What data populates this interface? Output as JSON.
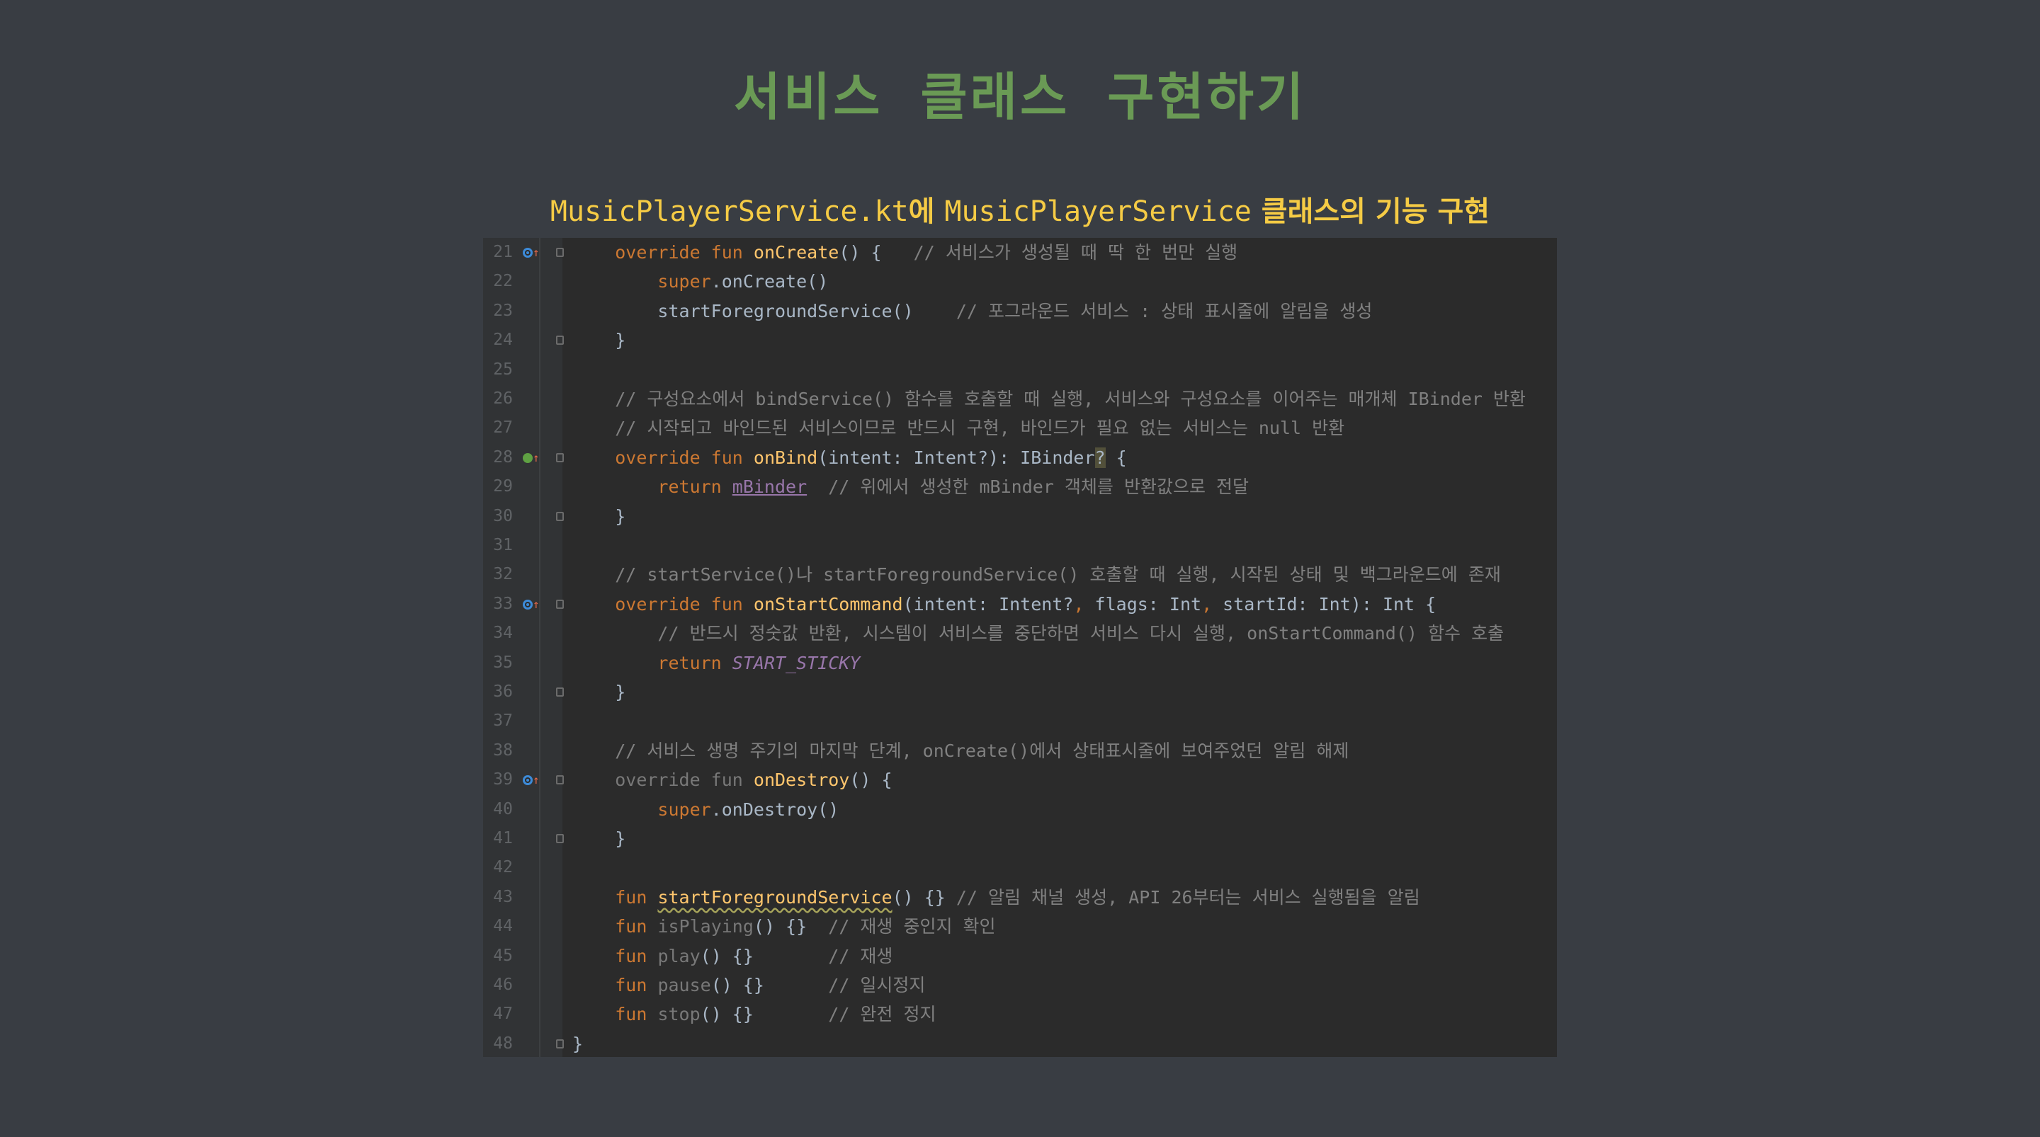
{
  "slide": {
    "title": "서비스 클래스 구현하기",
    "subtitle_file": "MusicPlayerService.kt",
    "subtitle_part1": "에 ",
    "subtitle_class": "MusicPlayerService",
    "subtitle_part2": " 클래스의 기능 구현"
  },
  "editor": {
    "lines": [
      {
        "no": "21",
        "marker": "override",
        "fold": true,
        "segments": [
          {
            "t": "    "
          },
          {
            "t": "override fun ",
            "c": "kw"
          },
          {
            "t": "onCreate",
            "c": "fn"
          },
          {
            "t": "() {   "
          },
          {
            "t": "// 서비스가 생성될 때 딱 한 번만 실행",
            "c": "cm"
          }
        ]
      },
      {
        "no": "22",
        "segments": [
          {
            "t": "        "
          },
          {
            "t": "super",
            "c": "kw"
          },
          {
            "t": ".onCreate()"
          }
        ]
      },
      {
        "no": "23",
        "segments": [
          {
            "t": "        startForegroundService()    "
          },
          {
            "t": "// 포그라운드 서비스 : 상태 표시줄에 알림을 생성",
            "c": "cm"
          }
        ]
      },
      {
        "no": "24",
        "fold": true,
        "segments": [
          {
            "t": "    }"
          }
        ]
      },
      {
        "no": "25",
        "segments": [
          {
            "t": ""
          }
        ]
      },
      {
        "no": "26",
        "segments": [
          {
            "t": "    "
          },
          {
            "t": "// 구성요소에서 bindService() 함수를 호출할 때 실행, 서비스와 구성요소를 이어주는 매개체 IBinder 반환",
            "c": "cm"
          }
        ]
      },
      {
        "no": "27",
        "segments": [
          {
            "t": "    "
          },
          {
            "t": "// 시작되고 바인드된 서비스이므로 반드시 구현, 바인드가 필요 없는 서비스는 null 반환",
            "c": "cm"
          }
        ]
      },
      {
        "no": "28",
        "marker": "implement",
        "fold": true,
        "segments": [
          {
            "t": "    "
          },
          {
            "t": "override fun ",
            "c": "kw"
          },
          {
            "t": "onBind",
            "c": "fn"
          },
          {
            "t": "(intent: Intent?): IBinder"
          },
          {
            "t": "?",
            "c": "caret"
          },
          {
            "t": " {"
          }
        ]
      },
      {
        "no": "29",
        "segments": [
          {
            "t": "        "
          },
          {
            "t": "return ",
            "c": "kw"
          },
          {
            "t": "mBinder",
            "c": "propu"
          },
          {
            "t": "  "
          },
          {
            "t": "// 위에서 생성한 mBinder 객체를 반환값으로 전달",
            "c": "cm"
          }
        ]
      },
      {
        "no": "30",
        "fold": true,
        "segments": [
          {
            "t": "    }"
          }
        ]
      },
      {
        "no": "31",
        "segments": [
          {
            "t": ""
          }
        ]
      },
      {
        "no": "32",
        "segments": [
          {
            "t": "    "
          },
          {
            "t": "// startService()나 startForegroundService() 호출할 때 실행, 시작된 상태 및 백그라운드에 존재",
            "c": "cm"
          }
        ]
      },
      {
        "no": "33",
        "marker": "override",
        "fold": true,
        "segments": [
          {
            "t": "    "
          },
          {
            "t": "override fun ",
            "c": "kw"
          },
          {
            "t": "onStartCommand",
            "c": "fn"
          },
          {
            "t": "(intent: Intent?"
          },
          {
            "t": ", ",
            "c": "kw"
          },
          {
            "t": "flags: Int"
          },
          {
            "t": ", ",
            "c": "kw"
          },
          {
            "t": "startId: Int): Int {"
          }
        ]
      },
      {
        "no": "34",
        "segments": [
          {
            "t": "        "
          },
          {
            "t": "// 반드시 정숫값 반환, 시스템이 서비스를 중단하면 서비스 다시 실행, onStartCommand() 함수 호출",
            "c": "cm"
          }
        ]
      },
      {
        "no": "35",
        "segments": [
          {
            "t": "        "
          },
          {
            "t": "return ",
            "c": "kw"
          },
          {
            "t": "START_STICKY",
            "c": "const"
          }
        ]
      },
      {
        "no": "36",
        "fold": true,
        "segments": [
          {
            "t": "    }"
          }
        ]
      },
      {
        "no": "37",
        "segments": [
          {
            "t": ""
          }
        ]
      },
      {
        "no": "38",
        "segments": [
          {
            "t": "    "
          },
          {
            "t": "// 서비스 생명 주기의 마지막 단계, onCreate()에서 상태표시줄에 보여주었던 알림 해제",
            "c": "cm"
          }
        ]
      },
      {
        "no": "39",
        "marker": "override",
        "fold": true,
        "segments": [
          {
            "t": "    "
          },
          {
            "t": "override fun ",
            "c": "faded"
          },
          {
            "t": "onDestroy",
            "c": "fn"
          },
          {
            "t": "() {"
          }
        ]
      },
      {
        "no": "40",
        "segments": [
          {
            "t": "        "
          },
          {
            "t": "super",
            "c": "kw"
          },
          {
            "t": ".onDestroy()"
          }
        ]
      },
      {
        "no": "41",
        "fold": true,
        "segments": [
          {
            "t": "    }"
          }
        ]
      },
      {
        "no": "42",
        "segments": [
          {
            "t": ""
          }
        ]
      },
      {
        "no": "43",
        "segments": [
          {
            "t": "    "
          },
          {
            "t": "fun ",
            "c": "kw"
          },
          {
            "t": "startForegroundService",
            "c": "fn warn"
          },
          {
            "t": "() {} "
          },
          {
            "t": "// 알림 채널 생성, API 26부터는 서비스 실행됨을 알림",
            "c": "cm"
          }
        ]
      },
      {
        "no": "44",
        "segments": [
          {
            "t": "    "
          },
          {
            "t": "fun ",
            "c": "kw"
          },
          {
            "t": "isPlaying",
            "c": "faded"
          },
          {
            "t": "() {}  "
          },
          {
            "t": "// 재생 중인지 확인",
            "c": "cm"
          }
        ]
      },
      {
        "no": "45",
        "segments": [
          {
            "t": "    "
          },
          {
            "t": "fun ",
            "c": "kw"
          },
          {
            "t": "play",
            "c": "faded"
          },
          {
            "t": "() {}       "
          },
          {
            "t": "// 재생",
            "c": "cm"
          }
        ]
      },
      {
        "no": "46",
        "segments": [
          {
            "t": "    "
          },
          {
            "t": "fun ",
            "c": "kw"
          },
          {
            "t": "pause",
            "c": "faded"
          },
          {
            "t": "() {}      "
          },
          {
            "t": "// 일시정지",
            "c": "cm"
          }
        ]
      },
      {
        "no": "47",
        "segments": [
          {
            "t": "    "
          },
          {
            "t": "fun ",
            "c": "kw"
          },
          {
            "t": "stop",
            "c": "faded"
          },
          {
            "t": "() {}       "
          },
          {
            "t": "// 완전 정지",
            "c": "cm"
          }
        ]
      },
      {
        "no": "48",
        "fold": true,
        "foldEnd": true,
        "segments": [
          {
            "t": "}"
          }
        ]
      }
    ]
  }
}
